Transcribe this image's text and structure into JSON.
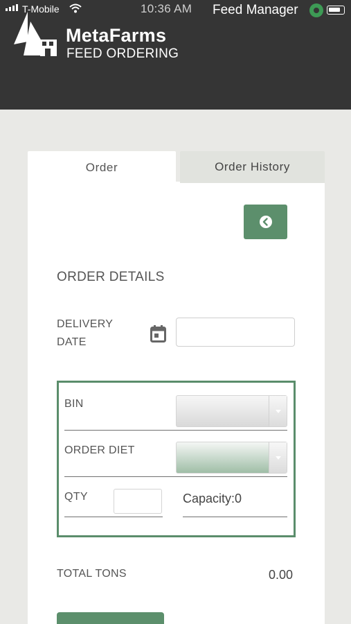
{
  "status_bar": {
    "carrier": "T-Mobile",
    "time": "10:36 AM",
    "app_name": "Feed Manager",
    "icons": [
      "signal-icon",
      "wifi-icon",
      "app-icon",
      "battery-icon"
    ]
  },
  "header": {
    "brand": "MetaFarms",
    "subtitle": "FEED ORDERING",
    "logo_icon": "sail-logo-icon",
    "background": "#353535"
  },
  "tabs": [
    {
      "label": "Order",
      "active": true
    },
    {
      "label": "Order History",
      "active": false
    }
  ],
  "back_button": {
    "icon": "arrow-left-circle-icon",
    "color": "#5c8f6c"
  },
  "form": {
    "section_title": "ORDER DETAILS",
    "delivery_date_label": "DELIVERY DATE",
    "calendar_icon": "calendar-icon",
    "delivery_date_value": "",
    "bin_label": "BIN",
    "bin_value": "",
    "order_diet_label": "ORDER DIET",
    "order_diet_value": "",
    "qty_label": "QTY",
    "qty_value": "",
    "capacity_text": "Capacity:0"
  },
  "totals": {
    "total_tons_label": "TOTAL TONS",
    "total_tons_value": "0.00"
  },
  "colors": {
    "accent": "#5c8f6c",
    "page_background": "#e9e9e6"
  }
}
